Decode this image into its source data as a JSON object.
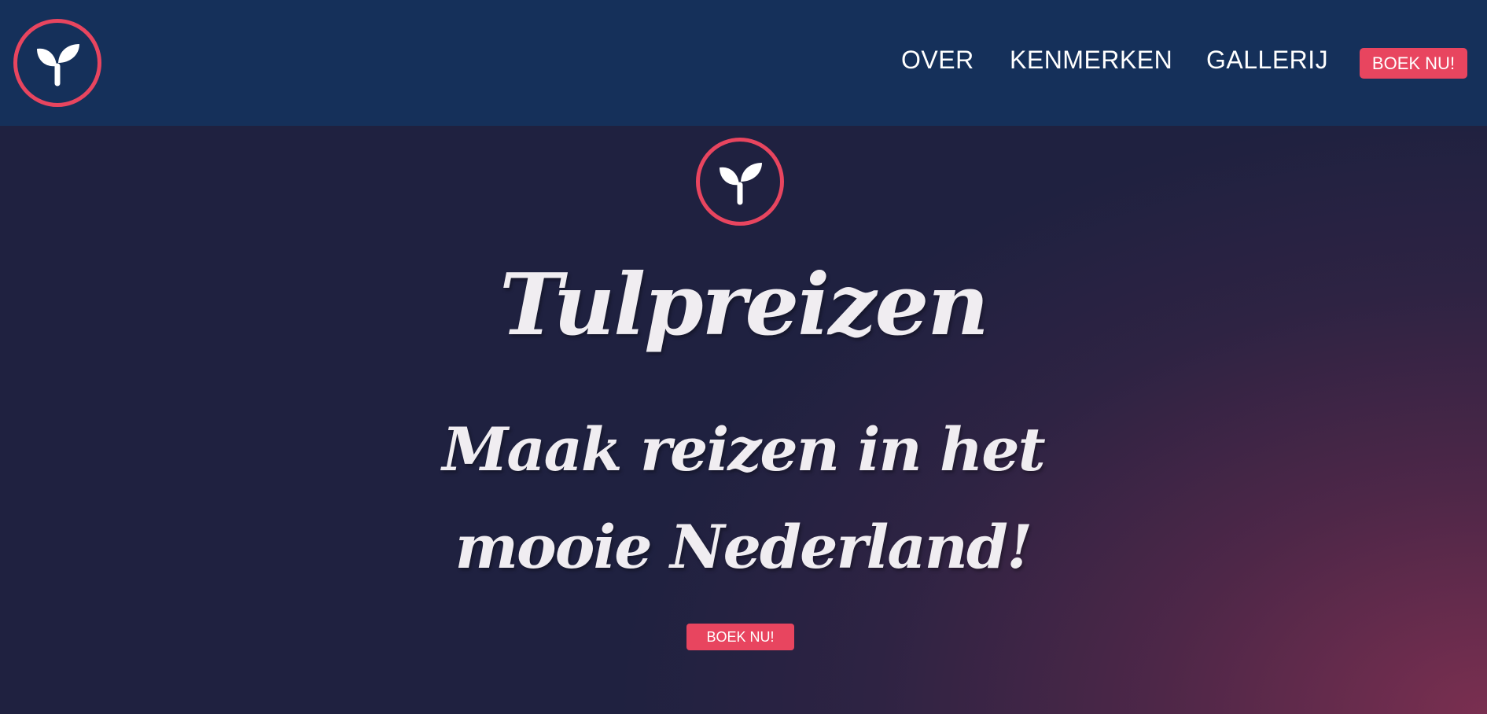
{
  "brand": {
    "logo_icon": "sprout-icon",
    "accent_color": "#e8455f",
    "header_color": "#15305a"
  },
  "nav": {
    "items": [
      {
        "label": "OVER"
      },
      {
        "label": "KENMERKEN"
      },
      {
        "label": "GALLERIJ"
      }
    ],
    "cta_label": "BOEK NU!"
  },
  "hero": {
    "icon": "sprout-icon",
    "title": "Tulpreizen",
    "tagline": "Maak reizen in het mooie Nederland!",
    "cta_label": "BOEK NU!"
  }
}
